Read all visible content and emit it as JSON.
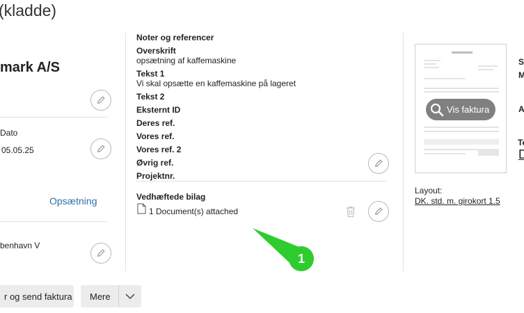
{
  "page": {
    "title": "(kladde)"
  },
  "left": {
    "company_name": "mark A/S",
    "date_label": "Dato",
    "date_value": "05.05.25",
    "setup_link": "Opsætning",
    "address_line": "benhavn V"
  },
  "notes": {
    "section_title": "Noter og referencer",
    "heading_label": "Overskrift",
    "heading_value": "opsætning af kaffemaskine",
    "text1_label": "Tekst 1",
    "text1_value": "Vi skal opsætte en kaffemaskine på lageret",
    "text2_label": "Tekst 2",
    "external_id_label": "Eksternt ID",
    "their_ref_label": "Deres ref.",
    "our_ref_label": "Vores ref.",
    "our_ref2_label": "Vores ref. 2",
    "other_ref_label": "Øvrig ref.",
    "project_label": "Projektnr."
  },
  "attachments": {
    "title": "Vedhæftede bilag",
    "count_text": "1 Document(s) attached"
  },
  "preview": {
    "view_button": "Vis faktura",
    "layout_label": "Layout:",
    "layout_value": "DK. std. m. girokort 1.5"
  },
  "right_edge": {
    "letters": [
      "S",
      "M",
      "A",
      "Te",
      "D"
    ]
  },
  "toolbar": {
    "send_button": "r og send faktura",
    "more_button": "Mere"
  },
  "annotation": {
    "number": "1"
  },
  "colors": {
    "link": "#2f6fa7",
    "badge": "#2ecc2e"
  }
}
